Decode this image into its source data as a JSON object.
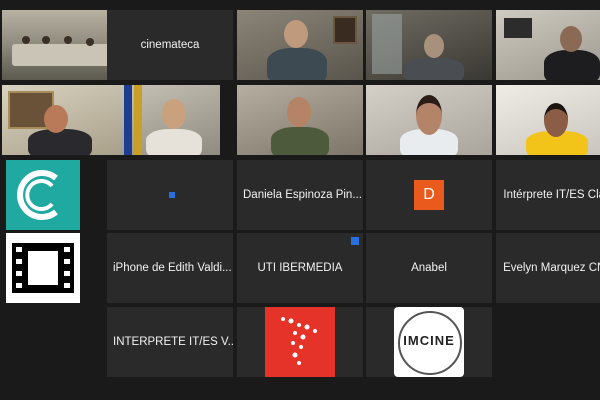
{
  "tiles": [
    {
      "name": "cinemateca"
    },
    {
      "name": "Daniela Espinoza Pin..."
    },
    {
      "name": "D"
    },
    {
      "name": "Intérprete IT/ES Cla..."
    },
    {
      "name": "iPhone de Edith Valdi..."
    },
    {
      "name": "UTI IBERMEDIA"
    },
    {
      "name": "Anabel"
    },
    {
      "name": "Evelyn Marquez CN..."
    },
    {
      "name": "INTÉRPRETE IT/ES V..."
    }
  ],
  "logos": {
    "imcine_text": "IMCINE"
  },
  "colors": {
    "background": "#1a1a1a",
    "tile": "#2a2a2a",
    "accent_blue": "#2a6fe0",
    "avatar_orange": "#ea5a1c",
    "cinemateca_teal": "#1fa9a1",
    "ibermedia_red": "#e5332a"
  }
}
